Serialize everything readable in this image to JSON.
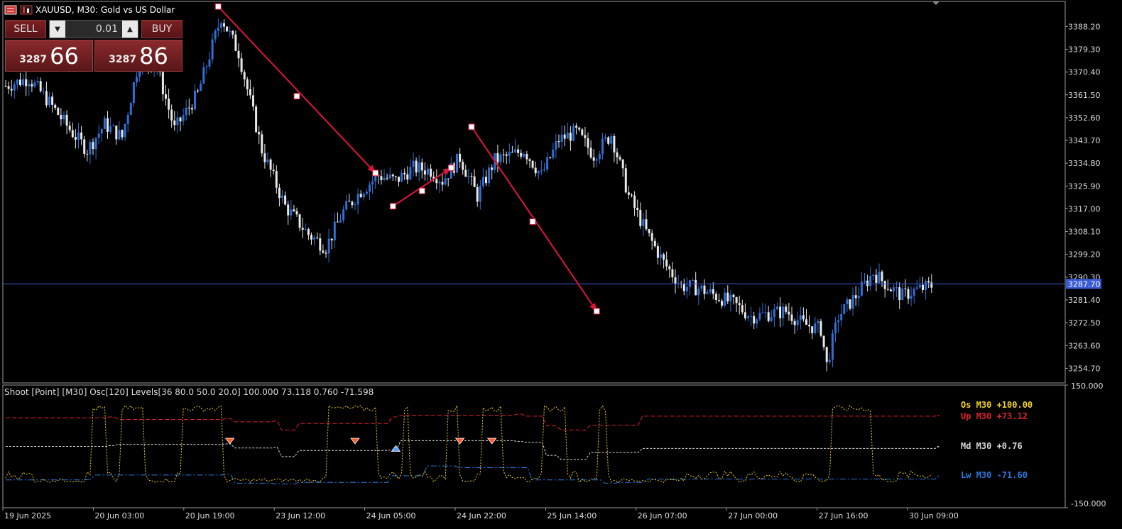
{
  "window": {
    "symbol_title": "XAUUSD, M30:  Gold vs US Dollar"
  },
  "trade_panel": {
    "sell_label": "SELL",
    "buy_label": "BUY",
    "lot_value": "0.01",
    "sell_price_main": "3287",
    "sell_price_pips": "66",
    "buy_price_main": "3287",
    "buy_price_pips": "86"
  },
  "colors": {
    "bull": "#2f6fd6",
    "bear": "#e8e8e8",
    "trend_arrow": "#e0143c",
    "price_line": "#3b5bd6",
    "osc_yellow": "#f0d020",
    "osc_red": "#e0202c",
    "osc_white": "#d8d8d8",
    "osc_blue": "#2a7ae0"
  },
  "chart_data": [
    {
      "type": "candlestick",
      "x_ticks": [
        "19 Jun 2025",
        "20 Jun 03:00",
        "20 Jun 19:00",
        "23 Jun 12:00",
        "24 Jun 05:00",
        "24 Jun 22:00",
        "25 Jun 14:00",
        "26 Jun 07:00",
        "27 Jun 00:00",
        "27 Jun 16:00",
        "30 Jun 09:00"
      ],
      "y_ticks": [
        "3388.20",
        "3379.30",
        "3370.40",
        "3361.50",
        "3352.60",
        "3343.70",
        "3334.80",
        "3325.90",
        "3317.00",
        "3308.10",
        "3299.20",
        "3290.30",
        "3281.40",
        "3272.50",
        "3263.60",
        "3254.70"
      ],
      "ylim": [
        3249.0,
        3398.0
      ],
      "current_price": 3287.7,
      "current_price_label": "3287.70",
      "path": [
        [
          0,
          3365
        ],
        [
          8,
          3368
        ],
        [
          14,
          3360
        ],
        [
          22,
          3348
        ],
        [
          28,
          3340
        ],
        [
          34,
          3350
        ],
        [
          40,
          3345
        ],
        [
          46,
          3376
        ],
        [
          52,
          3372
        ],
        [
          58,
          3348
        ],
        [
          66,
          3362
        ],
        [
          74,
          3392
        ],
        [
          80,
          3378
        ],
        [
          88,
          3340
        ],
        [
          96,
          3318
        ],
        [
          104,
          3307
        ],
        [
          110,
          3302
        ],
        [
          116,
          3316
        ],
        [
          122,
          3324
        ],
        [
          128,
          3330
        ],
        [
          134,
          3328
        ],
        [
          140,
          3333
        ],
        [
          146,
          3332
        ],
        [
          150,
          3328
        ],
        [
          156,
          3337
        ],
        [
          162,
          3322
        ],
        [
          168,
          3336
        ],
        [
          174,
          3338
        ],
        [
          178,
          3340
        ],
        [
          184,
          3330
        ],
        [
          190,
          3344
        ],
        [
          196,
          3347
        ],
        [
          202,
          3338
        ],
        [
          208,
          3346
        ],
        [
          214,
          3322
        ],
        [
          220,
          3308
        ],
        [
          226,
          3296
        ],
        [
          232,
          3287
        ],
        [
          238,
          3286
        ],
        [
          244,
          3283
        ],
        [
          250,
          3280
        ],
        [
          256,
          3275
        ],
        [
          262,
          3276
        ],
        [
          268,
          3277
        ],
        [
          274,
          3272
        ],
        [
          280,
          3270
        ],
        [
          282,
          3256
        ],
        [
          286,
          3275
        ],
        [
          292,
          3283
        ],
        [
          298,
          3292
        ],
        [
          304,
          3286
        ],
        [
          308,
          3283
        ],
        [
          312,
          3285
        ],
        [
          318,
          3287
        ]
      ],
      "arrows": [
        {
          "from": [
            73,
            3396
          ],
          "mid": [
            100,
            3361
          ],
          "to": [
            127,
            3331
          ]
        },
        {
          "from": [
            133,
            3318
          ],
          "mid": [
            143,
            3324
          ],
          "to": [
            153,
            3333
          ]
        },
        {
          "from": [
            160,
            3349
          ],
          "mid": [
            181,
            3312
          ],
          "to": [
            203,
            3277
          ]
        }
      ]
    },
    {
      "type": "line",
      "header": "Shoot [Point] [M30]  Osc[120]  Levels[36 80.0 50.0 20.0] 100.000 73.118 0.760 -71.598",
      "y_ticks": [
        "150.000",
        "-150.000"
      ],
      "ylim": [
        -150,
        150
      ],
      "series": [
        {
          "name": "Os",
          "legend": "Os   M30   +100.00",
          "color": "#f0d020"
        },
        {
          "name": "Up",
          "legend": "Up   M30   +73.12",
          "color": "#e0202c",
          "steps": [
            [
              0,
              70
            ],
            [
              35,
              72
            ],
            [
              38,
              66
            ],
            [
              75,
              68
            ],
            [
              78,
              60
            ],
            [
              92,
              63
            ],
            [
              94,
              40
            ],
            [
              100,
              56
            ],
            [
              132,
              72
            ],
            [
              135,
              76
            ],
            [
              175,
              79
            ],
            [
              178,
              74
            ],
            [
              185,
              50
            ],
            [
              190,
              40
            ],
            [
              200,
              52
            ],
            [
              218,
              74
            ],
            [
              320,
              76
            ]
          ]
        },
        {
          "name": "Md",
          "legend": "Md   M30   +0.76",
          "color": "#d8d8d8",
          "steps": [
            [
              0,
              0
            ],
            [
              35,
              2
            ],
            [
              38,
              5
            ],
            [
              75,
              6
            ],
            [
              78,
              -4
            ],
            [
              92,
              -2
            ],
            [
              94,
              -25
            ],
            [
              100,
              -10
            ],
            [
              132,
              -8
            ],
            [
              135,
              14
            ],
            [
              175,
              12
            ],
            [
              178,
              10
            ],
            [
              185,
              -22
            ],
            [
              190,
              -32
            ],
            [
              200,
              -15
            ],
            [
              218,
              -5
            ],
            [
              320,
              0
            ]
          ]
        },
        {
          "name": "Lw",
          "legend": "Lw   M30   -71.60",
          "color": "#2a7ae0",
          "steps": [
            [
              0,
              -82
            ],
            [
              28,
              -80
            ],
            [
              30,
              -70
            ],
            [
              75,
              -68
            ],
            [
              78,
              -90
            ],
            [
              92,
              -92
            ],
            [
              100,
              -88
            ],
            [
              132,
              -72
            ],
            [
              144,
              -48
            ],
            [
              155,
              -52
            ],
            [
              180,
              -82
            ],
            [
              205,
              -90
            ],
            [
              210,
              -88
            ],
            [
              220,
              -80
            ],
            [
              320,
              -72
            ]
          ]
        }
      ],
      "signals": [
        {
          "x": 77,
          "dir": "down",
          "color": "#ff5a2a"
        },
        {
          "x": 120,
          "dir": "down",
          "color": "#ff5a2a"
        },
        {
          "x": 134,
          "dir": "up",
          "color": "#5aa0ff"
        },
        {
          "x": 156,
          "dir": "down",
          "color": "#ff5a2a"
        },
        {
          "x": 167,
          "dir": "down",
          "color": "#ff5a2a"
        }
      ]
    }
  ]
}
